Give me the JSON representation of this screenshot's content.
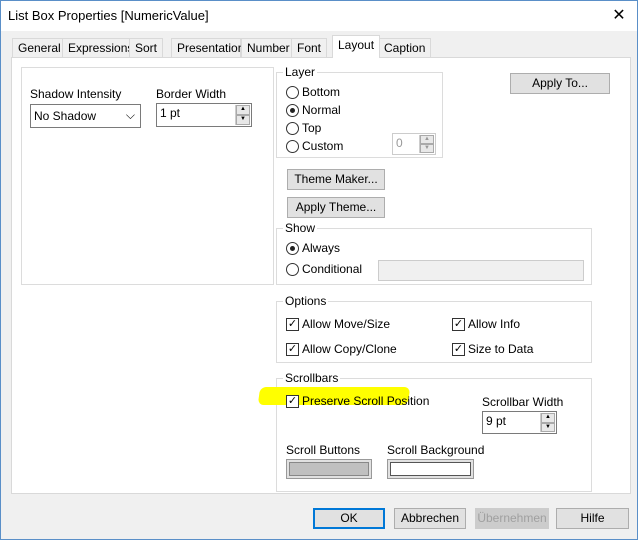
{
  "window": {
    "title": "List Box Properties [NumericValue]",
    "close": "✕"
  },
  "tabs": [
    "General",
    "Expressions",
    "Sort",
    "Presentation",
    "Number",
    "Font",
    "Layout",
    "Caption"
  ],
  "left": {
    "shadow_label": "Shadow Intensity",
    "shadow_value": "No Shadow",
    "border_label": "Border Width",
    "border_value": "1 pt"
  },
  "layer": {
    "label": "Layer",
    "options": [
      "Bottom",
      "Normal",
      "Top",
      "Custom"
    ],
    "selected": "Normal",
    "custom_value": "0"
  },
  "apply_to": "Apply To...",
  "theme_maker": "Theme Maker...",
  "apply_theme": "Apply Theme...",
  "show": {
    "label": "Show",
    "options": [
      "Always",
      "Conditional"
    ],
    "selected": "Always"
  },
  "options": {
    "label": "Options",
    "items": [
      "Allow Move/Size",
      "Allow Info",
      "Allow Copy/Clone",
      "Size to Data"
    ]
  },
  "scrollbars": {
    "label": "Scrollbars",
    "preserve": "Preserve Scroll Position",
    "width_label": "Scrollbar Width",
    "width_value": "9 pt",
    "buttons_label": "Scroll Buttons",
    "background_label": "Scroll Background",
    "buttons_color": "#c0c0c0",
    "background_color": "#ffffff",
    "highlight": "#ffff00"
  },
  "footer": {
    "ok": "OK",
    "cancel": "Abbrechen",
    "apply": "Übernehmen",
    "help": "Hilfe"
  }
}
